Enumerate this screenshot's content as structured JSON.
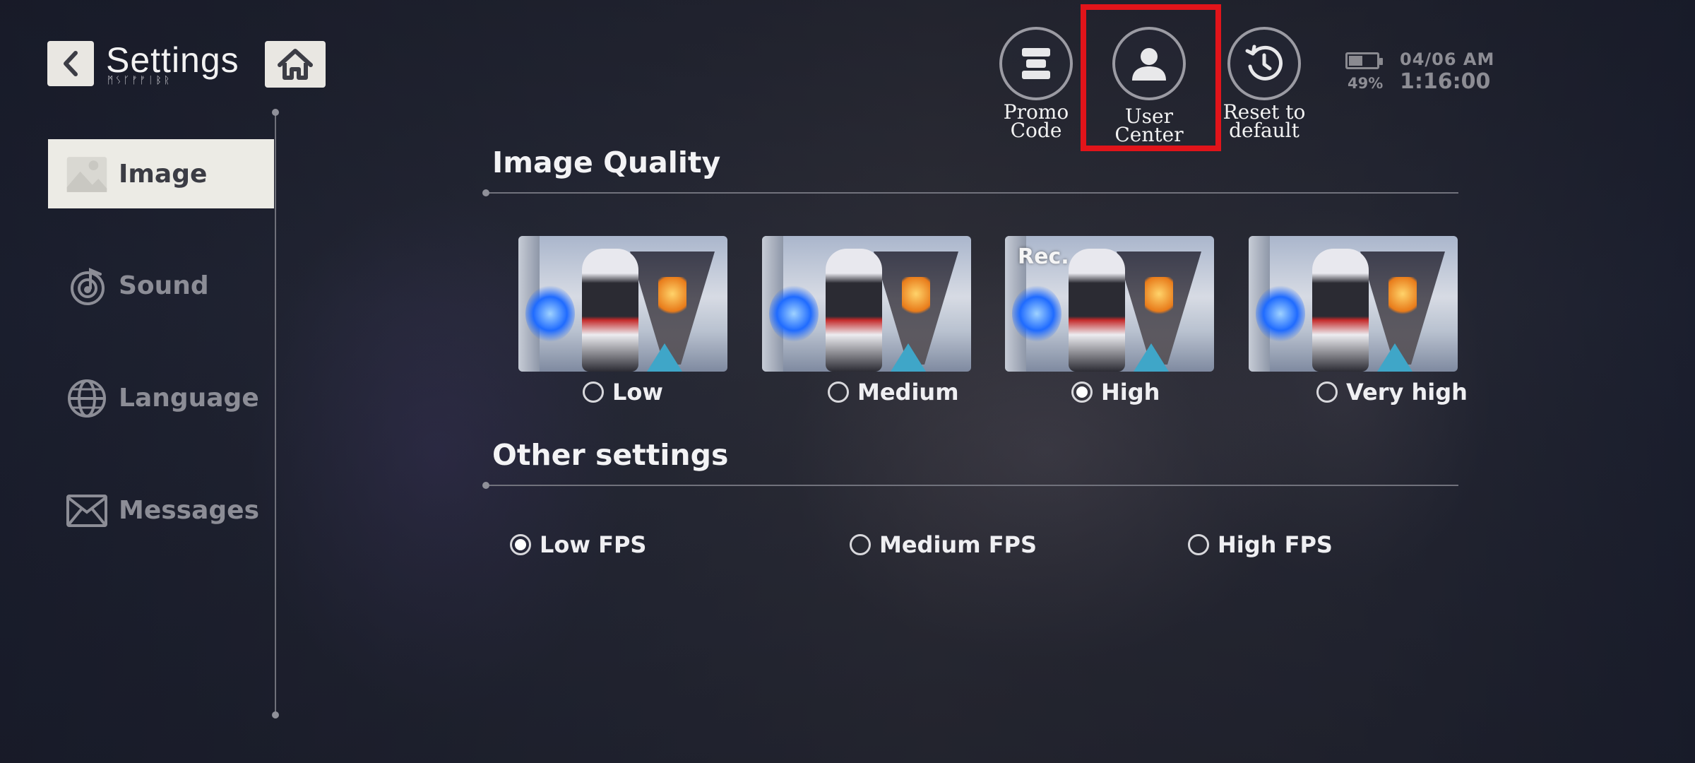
{
  "header": {
    "title": "Settings",
    "subtitle_runes": "ᛗᛊᚴᚠᚠᛁᛒᚱ"
  },
  "top_actions": [
    {
      "label_line1": "Promo",
      "label_line2": "Code",
      "icon": "promo-code-icon"
    },
    {
      "label_line1": "User Center",
      "label_line2": "",
      "icon": "user-icon"
    },
    {
      "label_line1": "Reset to",
      "label_line2": "default",
      "icon": "reset-history-icon"
    }
  ],
  "status": {
    "battery_percent": "49%",
    "battery_level": 0.49,
    "date": "04/06  AM",
    "time": "1:16:00"
  },
  "sidebar": {
    "items": [
      {
        "label": "Image",
        "icon": "image-icon",
        "active": true
      },
      {
        "label": "Sound",
        "icon": "sound-icon",
        "active": false
      },
      {
        "label": "Language",
        "icon": "globe-icon",
        "active": false
      },
      {
        "label": "Messages",
        "icon": "mail-icon",
        "active": false
      }
    ]
  },
  "image_quality": {
    "title": "Image Quality",
    "options": [
      {
        "label": "Low",
        "selected": false,
        "badge": ""
      },
      {
        "label": "Medium",
        "selected": false,
        "badge": ""
      },
      {
        "label": "High",
        "selected": true,
        "badge": "Rec."
      },
      {
        "label": "Very high",
        "selected": false,
        "badge": ""
      }
    ]
  },
  "other_settings": {
    "title": "Other settings",
    "options": [
      {
        "label": "Low FPS",
        "selected": true
      },
      {
        "label": "Medium FPS",
        "selected": false
      },
      {
        "label": "High FPS",
        "selected": false
      }
    ]
  },
  "colors": {
    "highlight": "#e1141a",
    "active_tab_bg": "#ecebe5"
  }
}
